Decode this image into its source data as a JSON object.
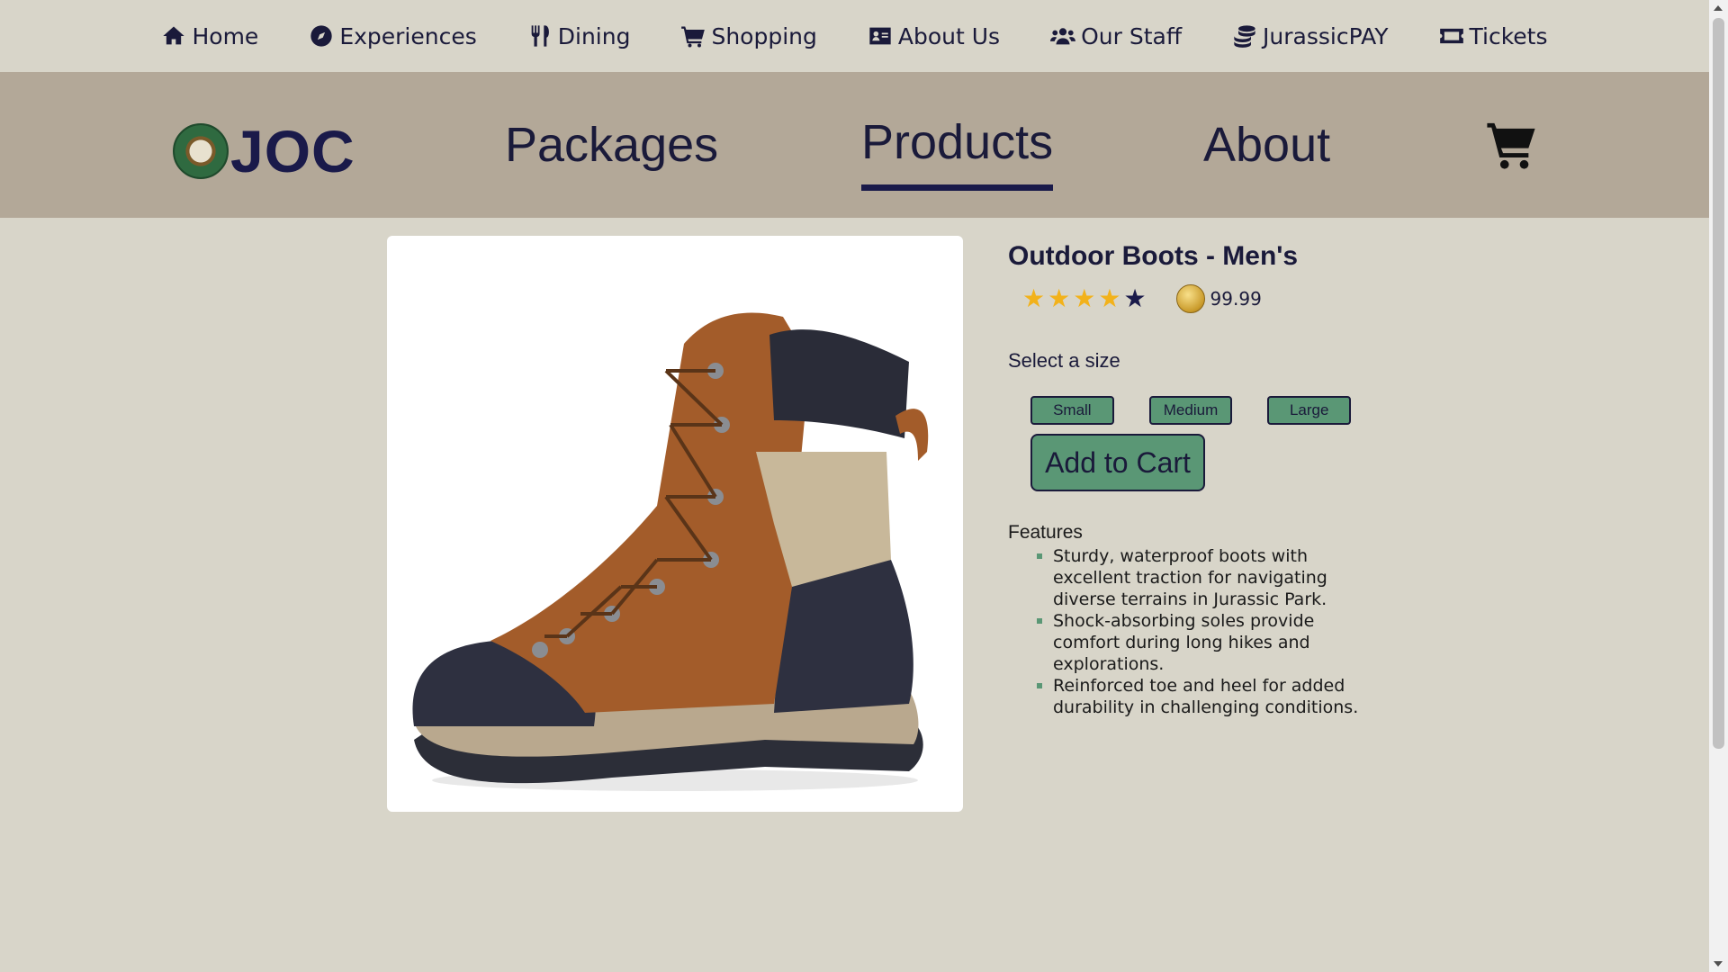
{
  "top_nav": {
    "items": [
      {
        "label": "Home",
        "icon": "home-icon"
      },
      {
        "label": "Experiences",
        "icon": "compass-icon"
      },
      {
        "label": "Dining",
        "icon": "utensils-icon"
      },
      {
        "label": "Shopping",
        "icon": "shopping-cart-icon"
      },
      {
        "label": "About Us",
        "icon": "id-card-icon"
      },
      {
        "label": "Our Staff",
        "icon": "users-icon"
      },
      {
        "label": "JurassicPAY",
        "icon": "coins-icon"
      },
      {
        "label": "Tickets",
        "icon": "ticket-icon"
      }
    ]
  },
  "main_header": {
    "logo_text": "JOC",
    "nav": {
      "packages": "Packages",
      "products": "Products",
      "about": "About"
    },
    "active": "Products",
    "cart_icon": "cart-icon"
  },
  "product": {
    "title": "Outdoor Boots - Men's",
    "rating": 4,
    "rating_max": 5,
    "price": "99.99",
    "currency_icon": "coin-icon",
    "size_label": "Select a size",
    "sizes": [
      "Small",
      "Medium",
      "Large"
    ],
    "add_to_cart": "Add to Cart",
    "features_title": "Features",
    "features": [
      "Sturdy, waterproof boots with excellent traction for navigating diverse terrains in Jurassic Park.",
      "Shock-absorbing soles provide comfort during long hikes and explorations.",
      "Reinforced toe and heel for added durability in challenging conditions."
    ]
  },
  "colors": {
    "page_bg": "#d8d5c9",
    "header_bg": "#b3a898",
    "text": "#1a1a3a",
    "button_green": "#5a9775",
    "star_gold": "#f2b21b"
  }
}
